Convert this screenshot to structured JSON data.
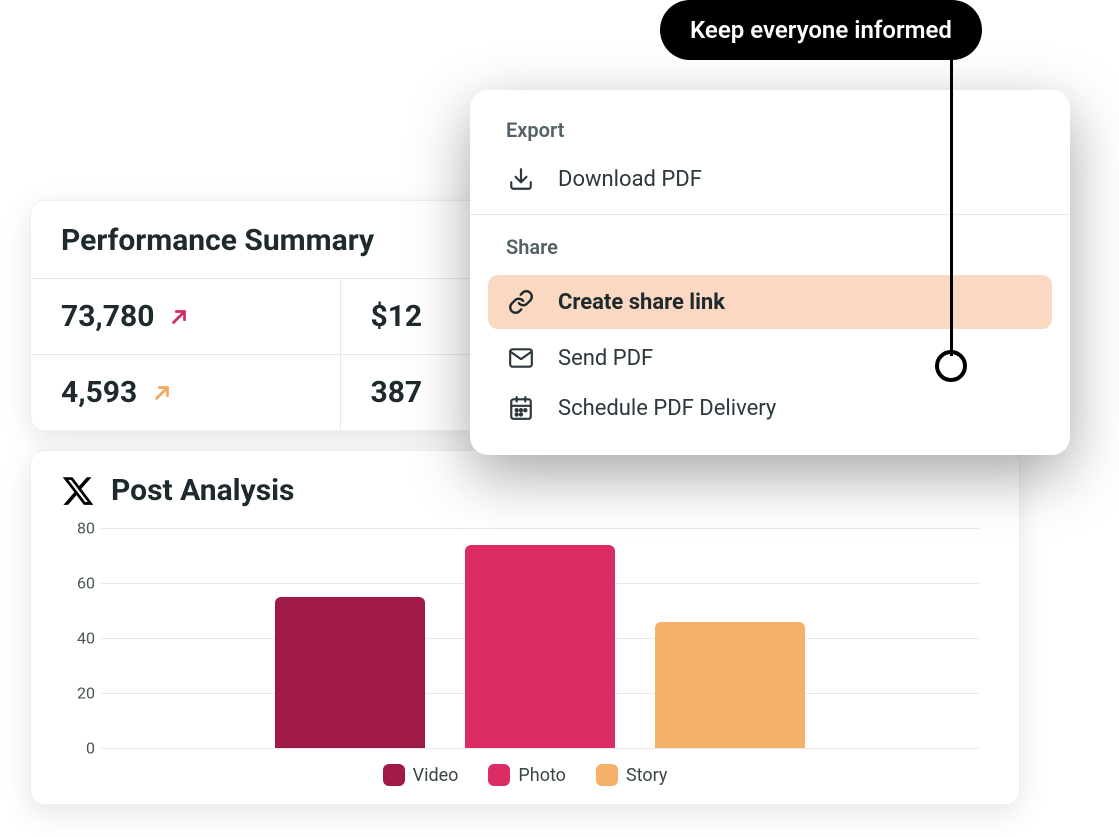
{
  "callout": "Keep everyone informed",
  "perf": {
    "title": "Performance Summary",
    "cells": [
      {
        "value": "73,780",
        "trend": "up",
        "trend_color": "#d32c60"
      },
      {
        "value": "$12"
      },
      {
        "value": "4,593",
        "trend": "up",
        "trend_color": "#f5a861"
      },
      {
        "value": "387"
      }
    ]
  },
  "post": {
    "title": "Post Analysis"
  },
  "popover": {
    "export_label": "Export",
    "download_pdf": "Download PDF",
    "share_label": "Share",
    "create_share_link": "Create share link",
    "send_pdf": "Send PDF",
    "schedule_pdf": "Schedule PDF Delivery"
  },
  "chart_data": {
    "type": "bar",
    "categories": [
      "Video",
      "Photo",
      "Story"
    ],
    "values": [
      55,
      74,
      46
    ],
    "colors": [
      "#9f1b46",
      "#dc2c64",
      "#f5b06a"
    ],
    "ylim": [
      0,
      80
    ],
    "yticks": [
      0,
      20,
      40,
      60,
      80
    ],
    "title": "Post Analysis",
    "xlabel": "",
    "ylabel": ""
  }
}
